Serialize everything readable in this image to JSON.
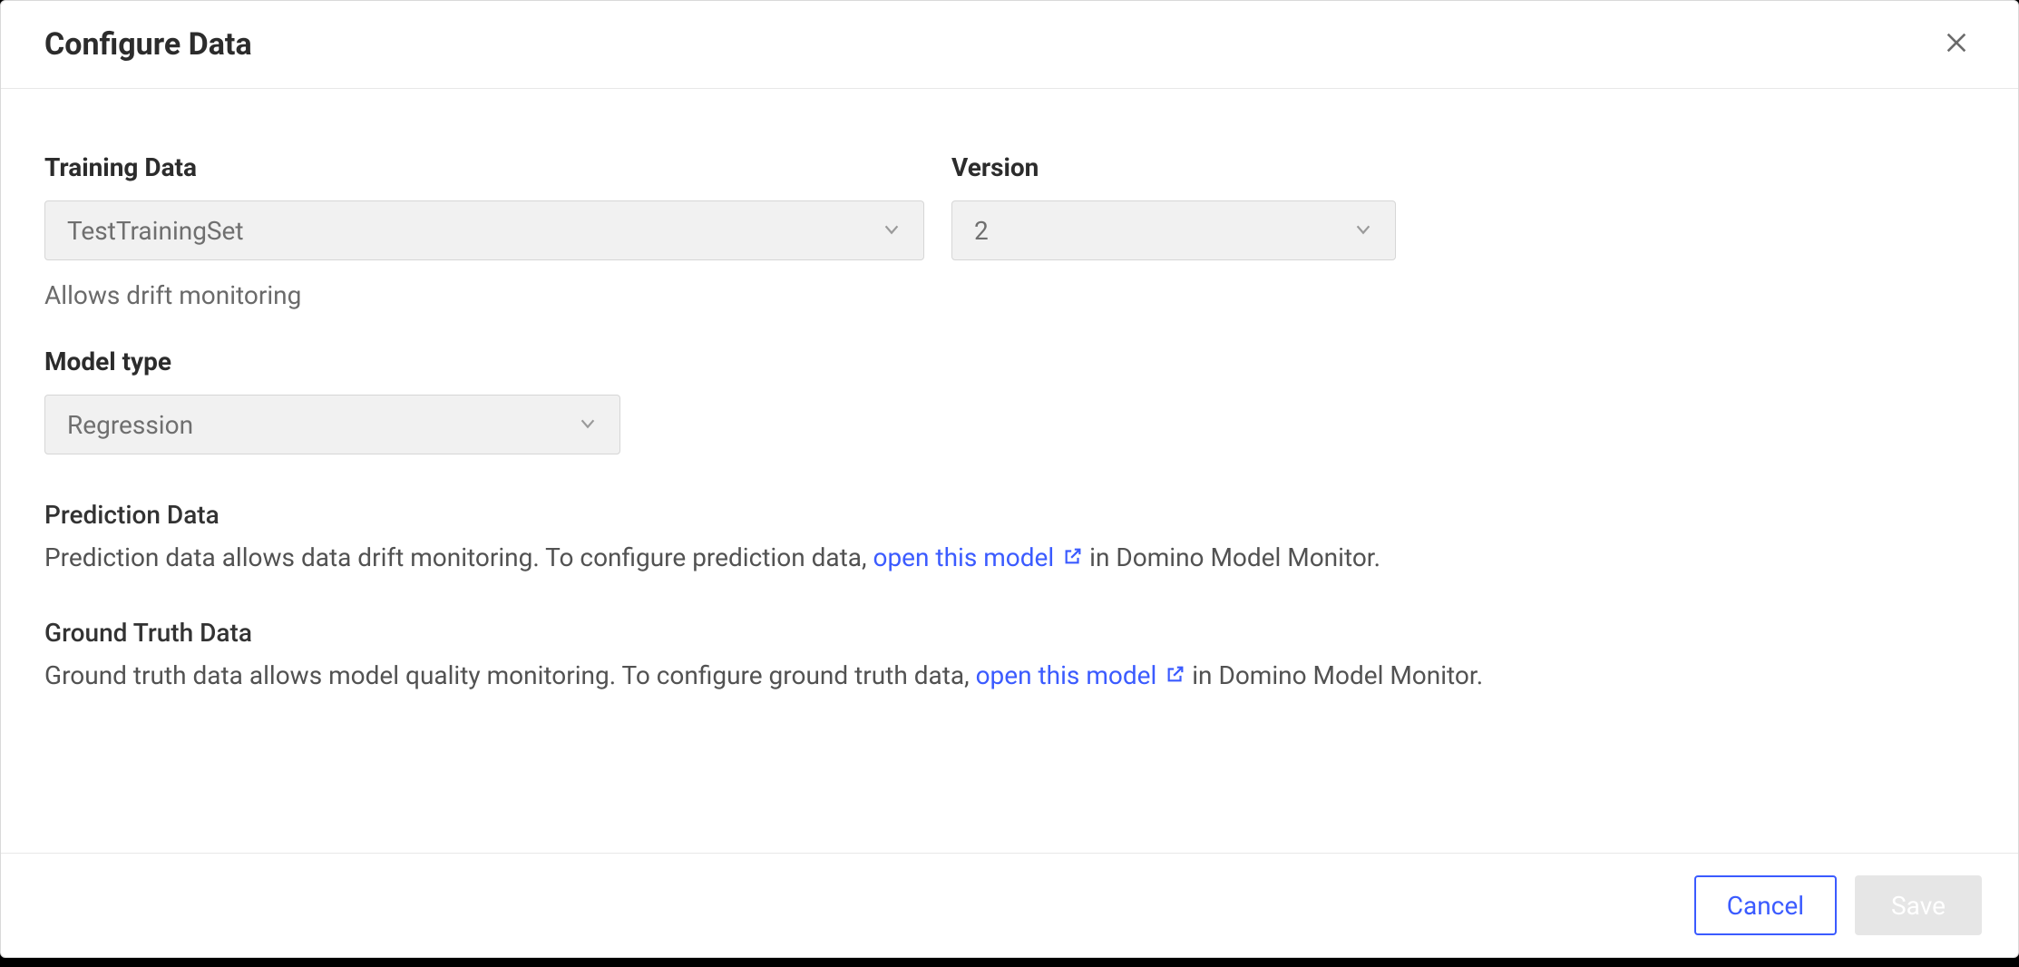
{
  "dialog": {
    "title": "Configure Data"
  },
  "training_data": {
    "label": "Training Data",
    "value": "TestTrainingSet",
    "help": "Allows drift monitoring"
  },
  "version": {
    "label": "Version",
    "value": "2"
  },
  "model_type": {
    "label": "Model type",
    "value": "Regression"
  },
  "prediction_data": {
    "title": "Prediction Data",
    "text_before": "Prediction data allows data drift monitoring. To configure prediction data, ",
    "link_text": "open this model",
    "text_after": " in Domino Model Monitor."
  },
  "ground_truth": {
    "title": "Ground Truth Data",
    "text_before": "Ground truth data allows model quality monitoring. To configure ground truth data, ",
    "link_text": "open this model",
    "text_after": " in Domino Model Monitor."
  },
  "footer": {
    "cancel": "Cancel",
    "save": "Save"
  }
}
